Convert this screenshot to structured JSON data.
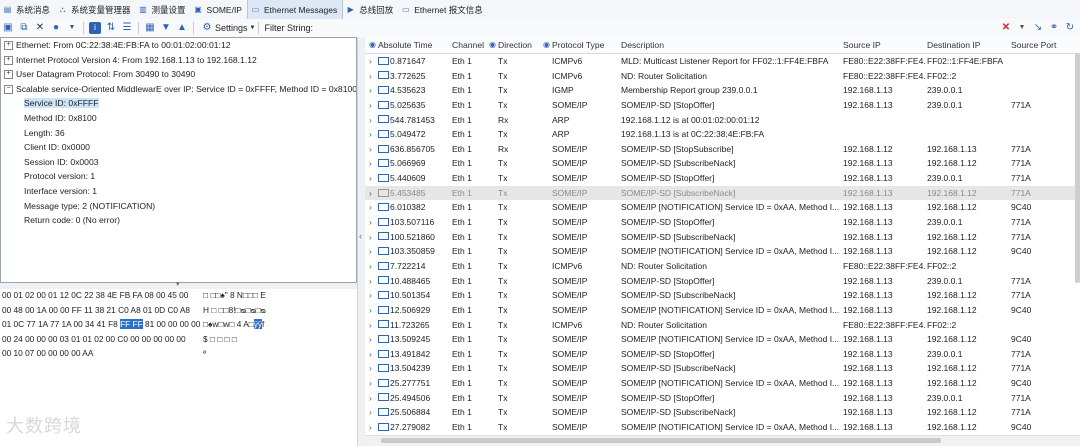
{
  "tabs": [
    {
      "label": "系统消息",
      "icon": "message-icon"
    },
    {
      "label": "系统变量管理器",
      "icon": "variable-icon"
    },
    {
      "label": "测量设置",
      "icon": "settings-icon"
    },
    {
      "label": "SOME/IP",
      "icon": "someip-icon"
    },
    {
      "label": "Ethernet Messages",
      "icon": "ethernet-icon",
      "active": true
    },
    {
      "label": "总线回放",
      "icon": "replay-icon"
    },
    {
      "label": "Ethernet 报文信息",
      "icon": "ethernet-info-icon"
    }
  ],
  "toolbar": {
    "settings_label": "Settings",
    "filter_label": "Filter String:",
    "filter_value": ""
  },
  "tree": {
    "top": [
      "Ethernet: From 0C:22:38:4E:FB:FA to 00:01:02:00:01:12",
      "Internet Protocol Version 4: From 192.168.1.13 to 192.168.1.12",
      "User Datagram Protocol: From 30490 to 30490",
      "Scalable service-Oriented MiddlewarE over IP: Service ID = 0xFFFF, Method ID = 0x8100"
    ],
    "children": [
      "Service ID: 0xFFFF",
      "Method ID: 0x8100",
      "Length: 36",
      "Client ID: 0x0000",
      "Session ID: 0x0003",
      "Protocol version: 1",
      "Interface version: 1",
      "Message type: 2 (NOTIFICATION)",
      "Return code: 0 (No error)"
    ]
  },
  "hex": {
    "rows": [
      {
        "bytes": "00 01 02 00 01 12 0C 22 38 4E FB FA 08 00 45 00",
        "ascii": "□        □□♠\" 8 N□□□      E"
      },
      {
        "bytes": "00 48 00 1A 00 00 FF 11 38 21 C0 A8 01 0D C0 A8",
        "ascii": "H   □        □□8!□ᴓ□ᴓ□ᴓ"
      },
      {
        "bytes_pre": "01 0C 77 1A 77 1A 00 34 41 F8 ",
        "bytes_hl": "FF FF",
        "bytes_post": " 81 00 00 00 00",
        "ascii_pre": "□♠w□w□  4 A□",
        "ascii_hl": "ÿÿ",
        "ascii_post": "f"
      },
      {
        "bytes": "00 24 00 00 00 03 01 01 02 00 C0 00 00 00 00 00",
        "ascii": "$      □ □ □         □"
      },
      {
        "bytes": "00 10 07 00 00 00 00 AA",
        "ascii": "          ª"
      }
    ]
  },
  "columns": [
    "Absolute Time",
    "Channel",
    "Direction",
    "Protocol Type",
    "Description",
    "Source IP",
    "Destination IP",
    "Source Port"
  ],
  "rows": [
    {
      "time": "0.871647",
      "ch": "Eth 1",
      "dir": "Tx",
      "proto": "ICMPv6",
      "desc": "MLD: Multicast Listener Report for FF02::1:FF4E:FBFA",
      "src": "FE80::E22:38FF:FE4...",
      "dst": "FF02::1:FF4E:FBFA",
      "port": ""
    },
    {
      "time": "3.772625",
      "ch": "Eth 1",
      "dir": "Tx",
      "proto": "ICMPv6",
      "desc": "ND: Router Solicitation",
      "src": "FE80::E22:38FF:FE4...",
      "dst": "FF02::2",
      "port": ""
    },
    {
      "time": "4.535623",
      "ch": "Eth 1",
      "dir": "Tx",
      "proto": "IGMP",
      "desc": "Membership Report group 239.0.0.1",
      "src": "192.168.1.13",
      "dst": "239.0.0.1",
      "port": ""
    },
    {
      "time": "5.025635",
      "ch": "Eth 1",
      "dir": "Tx",
      "proto": "SOME/IP",
      "desc": "SOME/IP-SD [StopOffer]",
      "src": "192.168.1.13",
      "dst": "239.0.0.1",
      "port": "771A"
    },
    {
      "time": "544.781453",
      "ch": "Eth 1",
      "dir": "Rx",
      "proto": "ARP",
      "desc": "192.168.1.12 is at 00:01:02:00:01:12",
      "src": "",
      "dst": "",
      "port": ""
    },
    {
      "time": "5.049472",
      "ch": "Eth 1",
      "dir": "Tx",
      "proto": "ARP",
      "desc": "192.168.1.13 is at 0C:22:38:4E:FB:FA",
      "src": "",
      "dst": "",
      "port": ""
    },
    {
      "time": "636.856705",
      "ch": "Eth 1",
      "dir": "Rx",
      "proto": "SOME/IP",
      "desc": "SOME/IP-SD [StopSubscribe]",
      "src": "192.168.1.12",
      "dst": "192.168.1.13",
      "port": "771A"
    },
    {
      "time": "5.066969",
      "ch": "Eth 1",
      "dir": "Tx",
      "proto": "SOME/IP",
      "desc": "SOME/IP-SD [SubscribeNack]",
      "src": "192.168.1.13",
      "dst": "192.168.1.12",
      "port": "771A"
    },
    {
      "time": "5.440609",
      "ch": "Eth 1",
      "dir": "Tx",
      "proto": "SOME/IP",
      "desc": "SOME/IP-SD [StopOffer]",
      "src": "192.168.1.13",
      "dst": "239.0.0.1",
      "port": "771A"
    },
    {
      "time": "5.453485",
      "ch": "Eth 1",
      "dir": "Tx",
      "proto": "SOME/IP",
      "desc": "SOME/IP-SD [SubscribeNack]",
      "src": "192.168.1.13",
      "dst": "192.168.1.12",
      "port": "771A",
      "dim": true
    },
    {
      "time": "6.010382",
      "ch": "Eth 1",
      "dir": "Tx",
      "proto": "SOME/IP",
      "desc": "SOME/IP [NOTIFICATION] Service ID = 0xAA, Method I...",
      "src": "192.168.1.13",
      "dst": "192.168.1.12",
      "port": "9C40"
    },
    {
      "time": "103.507116",
      "ch": "Eth 1",
      "dir": "Tx",
      "proto": "SOME/IP",
      "desc": "SOME/IP-SD [StopOffer]",
      "src": "192.168.1.13",
      "dst": "239.0.0.1",
      "port": "771A"
    },
    {
      "time": "100.521860",
      "ch": "Eth 1",
      "dir": "Tx",
      "proto": "SOME/IP",
      "desc": "SOME/IP-SD [SubscribeNack]",
      "src": "192.168.1.13",
      "dst": "192.168.1.12",
      "port": "771A"
    },
    {
      "time": "103.350859",
      "ch": "Eth 1",
      "dir": "Tx",
      "proto": "SOME/IP",
      "desc": "SOME/IP [NOTIFICATION] Service ID = 0xAA, Method I...",
      "src": "192.168.1.13",
      "dst": "192.168.1.12",
      "port": "9C40"
    },
    {
      "time": "7.722214",
      "ch": "Eth 1",
      "dir": "Tx",
      "proto": "ICMPv6",
      "desc": "ND: Router Solicitation",
      "src": "FE80::E22:38FF:FE4...",
      "dst": "FF02::2",
      "port": ""
    },
    {
      "time": "10.488465",
      "ch": "Eth 1",
      "dir": "Tx",
      "proto": "SOME/IP",
      "desc": "SOME/IP-SD [StopOffer]",
      "src": "192.168.1.13",
      "dst": "239.0.0.1",
      "port": "771A"
    },
    {
      "time": "10.501354",
      "ch": "Eth 1",
      "dir": "Tx",
      "proto": "SOME/IP",
      "desc": "SOME/IP-SD [SubscribeNack]",
      "src": "192.168.1.13",
      "dst": "192.168.1.12",
      "port": "771A"
    },
    {
      "time": "12.506929",
      "ch": "Eth 1",
      "dir": "Tx",
      "proto": "SOME/IP",
      "desc": "SOME/IP [NOTIFICATION] Service ID = 0xAA, Method I...",
      "src": "192.168.1.13",
      "dst": "192.168.1.12",
      "port": "9C40"
    },
    {
      "time": "11.723265",
      "ch": "Eth 1",
      "dir": "Tx",
      "proto": "ICMPv6",
      "desc": "ND: Router Solicitation",
      "src": "FE80::E22:38FF:FE4...",
      "dst": "FF02::2",
      "port": ""
    },
    {
      "time": "13.509245",
      "ch": "Eth 1",
      "dir": "Tx",
      "proto": "SOME/IP",
      "desc": "SOME/IP [NOTIFICATION] Service ID = 0xAA, Method I...",
      "src": "192.168.1.13",
      "dst": "192.168.1.12",
      "port": "9C40"
    },
    {
      "time": "13.491842",
      "ch": "Eth 1",
      "dir": "Tx",
      "proto": "SOME/IP",
      "desc": "SOME/IP-SD [StopOffer]",
      "src": "192.168.1.13",
      "dst": "239.0.0.1",
      "port": "771A"
    },
    {
      "time": "13.504239",
      "ch": "Eth 1",
      "dir": "Tx",
      "proto": "SOME/IP",
      "desc": "SOME/IP-SD [SubscribeNack]",
      "src": "192.168.1.13",
      "dst": "192.168.1.12",
      "port": "771A"
    },
    {
      "time": "25.277751",
      "ch": "Eth 1",
      "dir": "Tx",
      "proto": "SOME/IP",
      "desc": "SOME/IP [NOTIFICATION] Service ID = 0xAA, Method I...",
      "src": "192.168.1.13",
      "dst": "192.168.1.12",
      "port": "9C40"
    },
    {
      "time": "25.494506",
      "ch": "Eth 1",
      "dir": "Tx",
      "proto": "SOME/IP",
      "desc": "SOME/IP-SD [StopOffer]",
      "src": "192.168.1.13",
      "dst": "239.0.0.1",
      "port": "771A"
    },
    {
      "time": "25.506884",
      "ch": "Eth 1",
      "dir": "Tx",
      "proto": "SOME/IP",
      "desc": "SOME/IP-SD [SubscribeNack]",
      "src": "192.168.1.13",
      "dst": "192.168.1.12",
      "port": "771A"
    },
    {
      "time": "27.279082",
      "ch": "Eth 1",
      "dir": "Tx",
      "proto": "SOME/IP",
      "desc": "SOME/IP [NOTIFICATION] Service ID = 0xAA, Method I...",
      "src": "192.168.1.13",
      "dst": "192.168.1.12",
      "port": "9C40"
    }
  ],
  "watermark": "大数跨境",
  "colors": {
    "accent": "#2f6fcc",
    "selected_row": "#cde3f7",
    "dim_row": "#e6e6e6"
  }
}
